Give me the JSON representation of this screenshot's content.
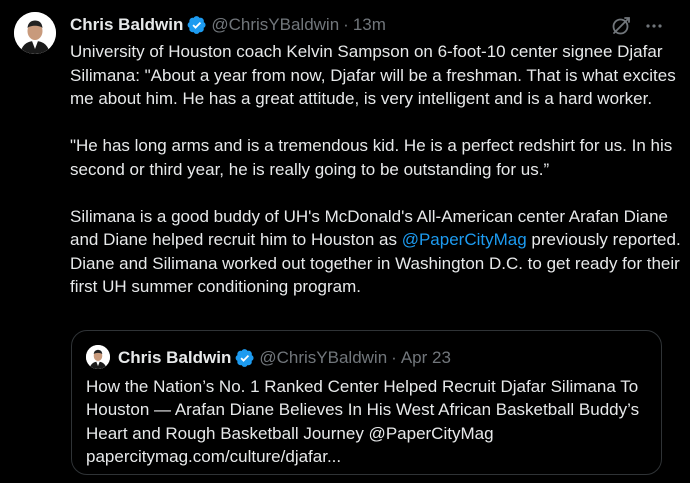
{
  "tweet": {
    "author_name": "Chris Baldwin",
    "handle": "@ChrisYBaldwin",
    "separator": "·",
    "time": "13m",
    "paragraph1": "University of Houston coach Kelvin Sampson on 6-foot-10 center signee Djafar Silimana: \"About a year from now, Djafar will be a freshman. That is what excites me about him. He has a great attitude, is very intelligent and is a hard worker.",
    "paragraph2": "\"He has long arms and is a tremendous kid. He is a perfect redshirt for us. In his second or third year, he is really going to be outstanding for us.”",
    "paragraph3_before": "Silimana is a good buddy of UH's McDonald's All-American center Arafan Diane and Diane helped recruit him to Houston as ",
    "paragraph3_mention": "@PaperCityMag",
    "paragraph3_after": " previously reported. Diane and Silimana worked out together in Washington D.C. to get ready for their first UH summer conditioning program."
  },
  "quoted_tweet": {
    "author_name": "Chris Baldwin",
    "handle": "@ChrisYBaldwin",
    "separator": "·",
    "date": "Apr 23",
    "text": "How the Nation’s No. 1 Ranked Center Helped Recruit Djafar Silimana To Houston — Arafan Diane Believes In His West African Basketball Buddy’s Heart and Rough Basketball Journey @PaperCityMag papercitymag.com/culture/djafar..."
  },
  "icons": {
    "verified": "verified-badge-icon",
    "grok": "grok-icon",
    "more": "more-options-icon"
  },
  "colors": {
    "background": "#000000",
    "text": "#e7e9ea",
    "muted": "#71767b",
    "link": "#1d9bf0",
    "verified": "#1d9bf0",
    "border": "#2f3336"
  }
}
